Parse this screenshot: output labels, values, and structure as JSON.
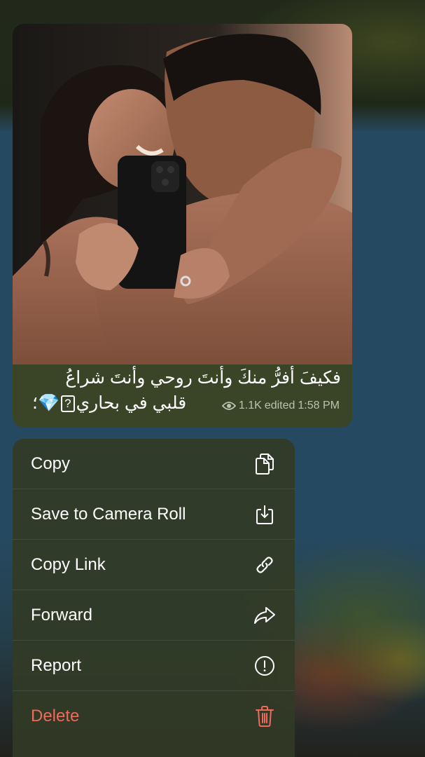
{
  "message": {
    "caption_line1": "فكيفَ أفرُّ منكَ وأنتَ روحي وأنتَ شراعُ",
    "caption_line2_text": "قلبي في بحاري",
    "caption_line2_box": "?",
    "caption_line2_emoji": "💎",
    "caption_line2_end": "؛",
    "views": "1.1K",
    "status": "edited",
    "time": "1:58 PM"
  },
  "menu": {
    "items": [
      {
        "label": "Copy",
        "icon": "copy-icon"
      },
      {
        "label": "Save to Camera Roll",
        "icon": "save-download-icon"
      },
      {
        "label": "Copy Link",
        "icon": "link-icon"
      },
      {
        "label": "Forward",
        "icon": "forward-arrow-icon"
      },
      {
        "label": "Report",
        "icon": "report-exclamation-icon"
      },
      {
        "label": "Delete",
        "icon": "trash-icon",
        "color": "#ee6a5a"
      }
    ]
  }
}
